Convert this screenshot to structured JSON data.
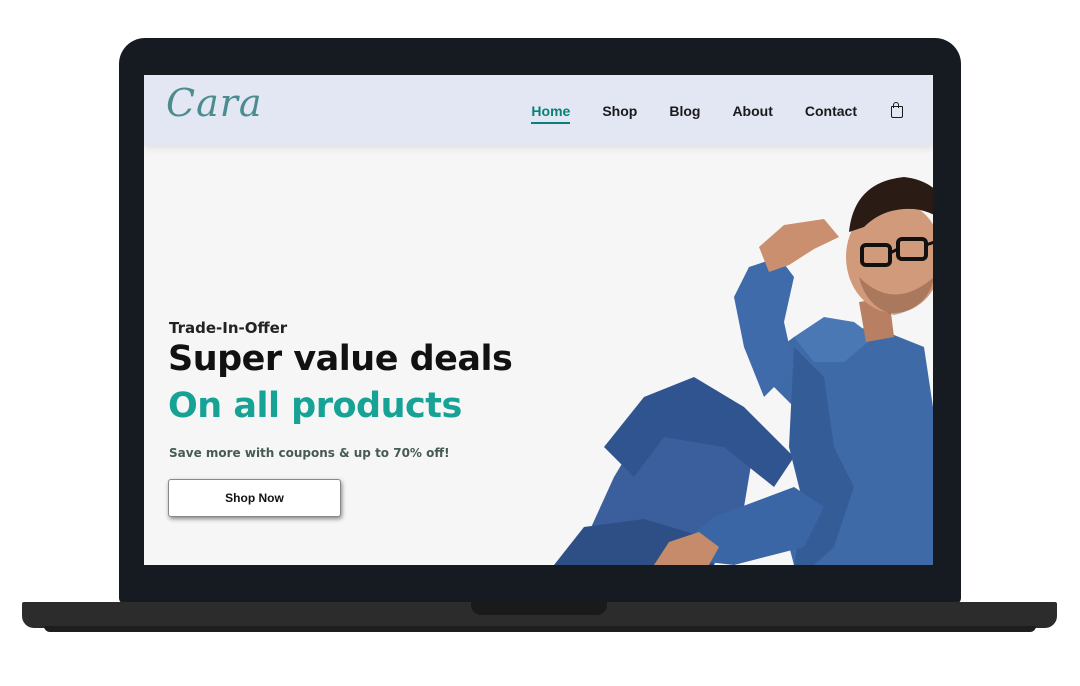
{
  "header": {
    "logo": "Cara",
    "nav": [
      {
        "label": "Home",
        "active": true
      },
      {
        "label": "Shop",
        "active": false
      },
      {
        "label": "Blog",
        "active": false
      },
      {
        "label": "About",
        "active": false
      },
      {
        "label": "Contact",
        "active": false
      }
    ],
    "cart_icon": "shopping-bag-icon"
  },
  "hero": {
    "subtitle": "Trade-In-Offer",
    "heading": "Super value deals",
    "heading_accent": "On all products",
    "description": "Save more with coupons & up to 70% off!",
    "cta_label": "Shop Now",
    "image": "man-in-denim-model"
  },
  "colors": {
    "accent": "#088178",
    "accent_text": "#16a295",
    "header_bg": "#e3e6f3",
    "laptop_frame": "#151b20"
  }
}
